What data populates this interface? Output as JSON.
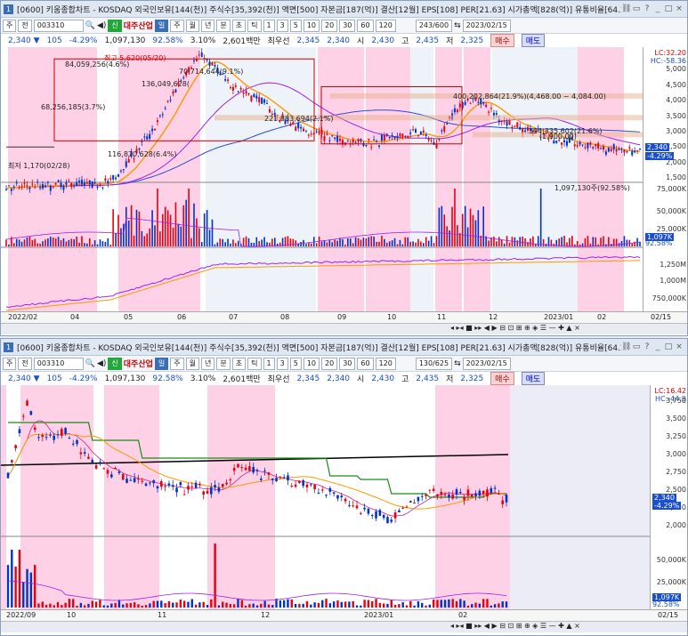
{
  "top": {
    "title": "[0600] 키움종합차트 - KOSDAQ 외국인보유[144(천)] 주식수[35,392(천)] 액면[500] 자본금[187(억)] 결산[12월] EPS[108] PER[21.63] 시가총액[828(억)] 유통비율[64.2",
    "winno": "1",
    "toolbar": {
      "mode": "주",
      "code": "003310",
      "theme": "대주산업",
      "period_sel": "일",
      "periods": [
        "주",
        "월",
        "년",
        "분",
        "초",
        "틱"
      ],
      "mins": [
        "1",
        "3",
        "5",
        "10",
        "20",
        "30",
        "60",
        "120"
      ],
      "count": "243/600",
      "date": "2023/02/15"
    },
    "quote": {
      "price": "2,340 ▼",
      "change": "105",
      "rate": "-4.29%",
      "volume": "1,097,130",
      "vol_rate": "92.58%",
      "turnover": "3.10%",
      "amount": "2,601백만",
      "best": "최우선",
      "ask": "2,345",
      "bid": "2,340",
      "open_l": "시",
      "open": "2,430",
      "high_l": "고",
      "high": "2,435",
      "low_l": "저",
      "low": "2,325",
      "buy": "매수",
      "sell": "매도"
    },
    "annotations": {
      "peak": "최고 5,620(05/20)",
      "a1": "84,059,256(4.6%)",
      "a2": "70,714,644(9.1%)",
      "a3": "136,049,628(",
      "a4": "68,256,185(3.7%)",
      "a5": "400,202,864(21.9%)(4,468.00 ~ 4,084.00)",
      "a6": "221,883,694(2.1%)",
      "a7": "394,335,602(21.6%)",
      "a8": "116,870,628(6.4%)",
      "low": "최저 1,170(02/28)",
      "a9": "(1,900.00)"
    },
    "price_axis": [
      "5,000",
      "4,500",
      "4,000",
      "3,500",
      "3,000",
      "2,500",
      "2,000",
      "1,500"
    ],
    "lc": "LC:32.20",
    "hc": "HC:-58.36",
    "last": "2,340",
    "last_rate": "-4.29%",
    "vol_label": "1,097,130주(92.58%)",
    "vol_axis": [
      "75,000K",
      "50,000K",
      "25,000K"
    ],
    "vol_last": "1,097K",
    "vol_rate": "92.58%",
    "obv_axis": [
      "1,250M",
      "1,000M",
      "750,000K"
    ],
    "dates": [
      "2022/02",
      "04",
      "05",
      "06",
      "07",
      "08",
      "09",
      "10",
      "11",
      "12",
      "2023/01",
      "02"
    ],
    "end_date": "02/15"
  },
  "bottom": {
    "title": "[0600] 키움종합차트 - KOSDAQ 외국인보유[144(천)] 주식수[35,392(천)] 액면[500] 자본금[187(억)] 결산[12월] EPS[108] PER[21.63] 시가총액[828(억)] 유통비율[64.2",
    "winno": "1",
    "toolbar": {
      "mode": "주",
      "code": "003310",
      "theme": "대주산업",
      "period_sel": "일",
      "periods": [
        "주",
        "월",
        "년",
        "분",
        "초",
        "틱"
      ],
      "mins": [
        "1",
        "3",
        "5",
        "10",
        "20",
        "30",
        "60",
        "120"
      ],
      "count": "130/625",
      "date": "2023/02/15"
    },
    "price_axis": [
      "3,750",
      "3,500",
      "3,250",
      "3,000",
      "2,750",
      "2,500",
      "2,250",
      "2,000"
    ],
    "lc": "LC:16.42",
    "hc": "HC:-44.9",
    "last": "2,340",
    "last_rate": "-4.29%",
    "vol_axis": [
      "50,000K",
      "25,000K"
    ],
    "vol_last": "1,097K",
    "vol_rate": "92.58%",
    "dates": [
      "2022/09",
      "10",
      "11",
      "12",
      "2023/01",
      "02"
    ],
    "end_date": "02/15"
  },
  "colors": {
    "up": "#e60012",
    "down": "#0033cc",
    "pink": "#ffd1e6",
    "pale": "#eef3fa"
  }
}
